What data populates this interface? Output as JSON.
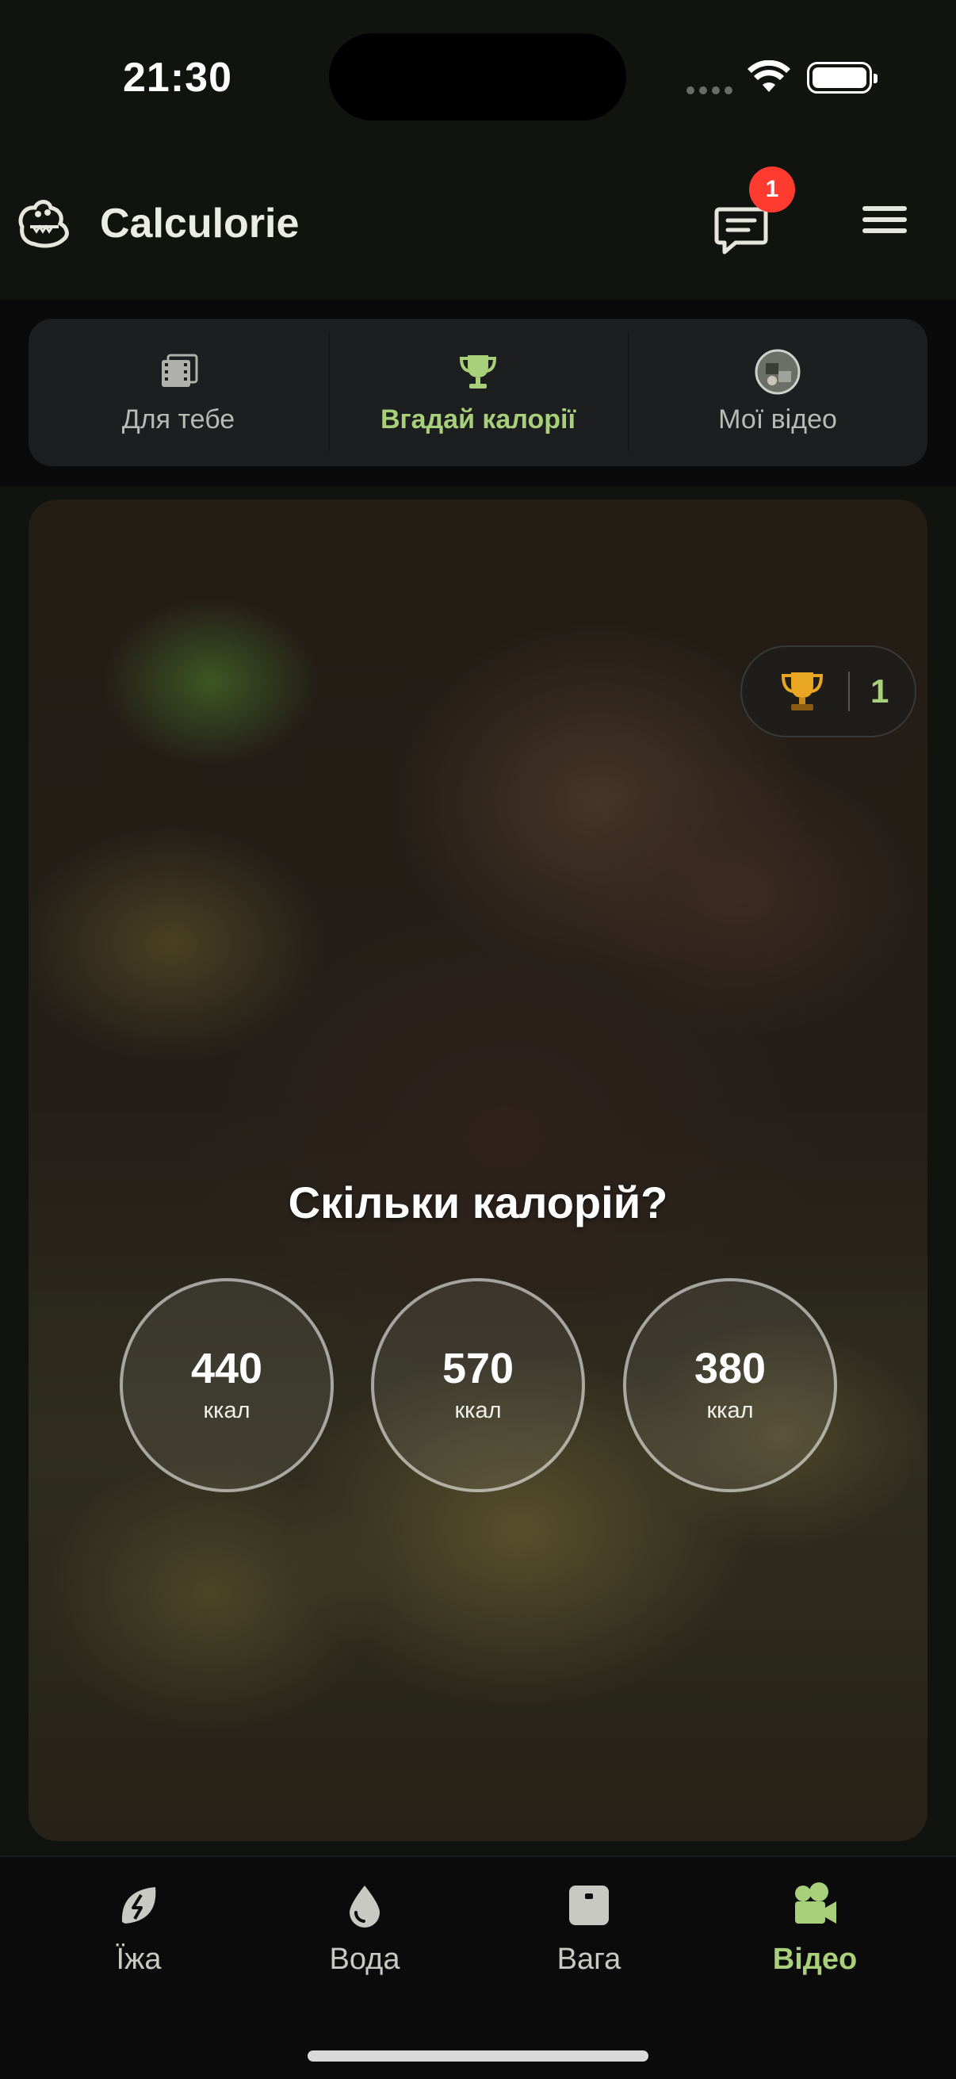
{
  "status_bar": {
    "time": "21:30"
  },
  "header": {
    "app_title": "Calculorie",
    "chat_badge": "1"
  },
  "top_tabs": [
    {
      "label": "Для тебе",
      "icon": "film-icon",
      "active": false
    },
    {
      "label": "Вгадай калорії",
      "icon": "trophy-icon",
      "active": true
    },
    {
      "label": "Мої відео",
      "icon": "avatar-icon",
      "active": false
    }
  ],
  "card": {
    "score": "1",
    "question": "Скільки калорій?",
    "answers": [
      {
        "value": "440",
        "unit": "ккал"
      },
      {
        "value": "570",
        "unit": "ккал"
      },
      {
        "value": "380",
        "unit": "ккал"
      }
    ]
  },
  "bottom_nav": [
    {
      "label": "Їжа",
      "icon": "food-leaf-icon",
      "active": false
    },
    {
      "label": "Вода",
      "icon": "water-drop-icon",
      "active": false
    },
    {
      "label": "Вага",
      "icon": "scale-icon",
      "active": false
    },
    {
      "label": "Відео",
      "icon": "video-camera-icon",
      "active": true
    }
  ],
  "colors": {
    "accent": "#a8cf7a",
    "badge": "#ff3b30",
    "background": "#11130f"
  }
}
